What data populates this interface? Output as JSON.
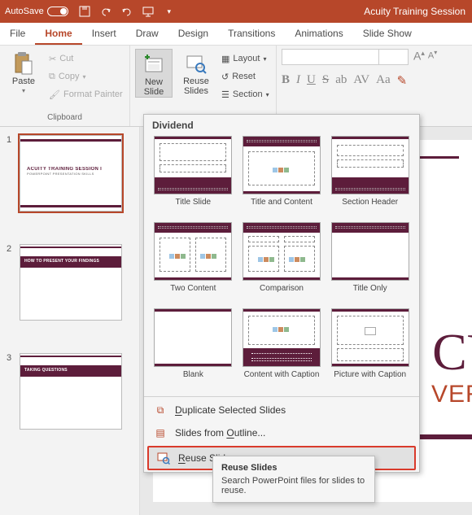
{
  "titlebar": {
    "autosave_label": "AutoSave",
    "autosave_state": "Off",
    "doc_title": "Acuity Training Session"
  },
  "tabs": {
    "file": "File",
    "home": "Home",
    "insert": "Insert",
    "draw": "Draw",
    "design": "Design",
    "transitions": "Transitions",
    "animations": "Animations",
    "slideshow": "Slide Show"
  },
  "ribbon": {
    "paste": "Paste",
    "cut": "Cut",
    "copy": "Copy",
    "format_painter": "Format Painter",
    "clipboard_label": "Clipboard",
    "new_slide": "New\nSlide",
    "reuse_slides": "Reuse\nSlides",
    "layout": "Layout",
    "reset": "Reset",
    "section": "Section",
    "font_size": "A"
  },
  "slides": {
    "s1_title": "ACUITY TRAINING SESSION I",
    "s1_sub": "POWERPOINT PRESENTATION SKILLS",
    "s2_band": "HOW TO PRESENT YOUR FINDINGS",
    "s3_band": "TAKING QUESTIONS"
  },
  "dropdown": {
    "theme": "Dividend",
    "layouts": {
      "l1": "Title Slide",
      "l2": "Title and Content",
      "l3": "Section Header",
      "l4": "Two Content",
      "l5": "Comparison",
      "l6": "Title Only",
      "l7": "Blank",
      "l8": "Content with Caption",
      "l9": "Picture with Caption"
    },
    "dup": "Duplicate Selected Slides",
    "outline": "Slides from Outline...",
    "reuse": "Reuse Slides"
  },
  "tooltip": {
    "title": "Reuse Slides",
    "body": "Search PowerPoint files for slides to reuse."
  },
  "canvas": {
    "big1": "CU",
    "big2": "VERPO"
  }
}
